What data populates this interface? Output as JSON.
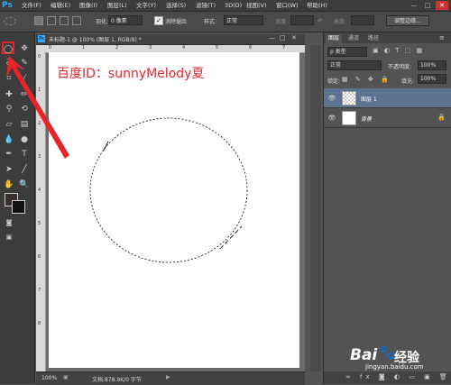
{
  "menubar": {
    "app_logo": "Ps",
    "items": [
      "文件(F)",
      "编辑(E)",
      "图像(I)",
      "图层(L)",
      "文字(Y)",
      "选择(S)",
      "滤镜(T)",
      "3D(D)",
      "视图(V)",
      "窗口(W)",
      "帮助(H)"
    ],
    "minimize": "—",
    "maximize": "□",
    "close": "✕"
  },
  "options": {
    "feather_label": "羽化:",
    "feather_value": "0 像素",
    "antialias_label": "消除锯齿",
    "style_label": "样式:",
    "style_value": "正常",
    "width_label": "宽度:",
    "height_label": "高度:",
    "refine_edge": "调整边缘..."
  },
  "document": {
    "tab_title": "未标题-1 @ 100% (图层 1, RGB/8) *",
    "ruler_top": [
      "0",
      "1",
      "2",
      "3",
      "4",
      "5",
      "6",
      "7"
    ],
    "ruler_left": [
      "0",
      "1",
      "2",
      "3",
      "4",
      "5",
      "6",
      "7",
      "8"
    ],
    "annotation": "百度ID：sunnyMelody夏",
    "zoom": "100%",
    "doc_info": "文档:878.9K/0 字节"
  },
  "panel": {
    "tabs": [
      "图层",
      "通道",
      "路径"
    ],
    "filter_type": "ρ 类型",
    "blend_mode": "正常",
    "opacity_label": "不透明度:",
    "opacity_value": "100%",
    "lock_label": "锁定:",
    "fill_label": "填充:",
    "fill_value": "100%",
    "layers": [
      {
        "name": "图层 1",
        "selected": true
      },
      {
        "name": "背景",
        "selected": false
      }
    ]
  },
  "watermark": {
    "brand": "Bai",
    "brand2": "经验",
    "url": "jingyan.baidu.com"
  },
  "colors": {
    "highlight": "#e8242b",
    "selected_layer": "#5b7391",
    "annotation_text": "#e8242b"
  }
}
